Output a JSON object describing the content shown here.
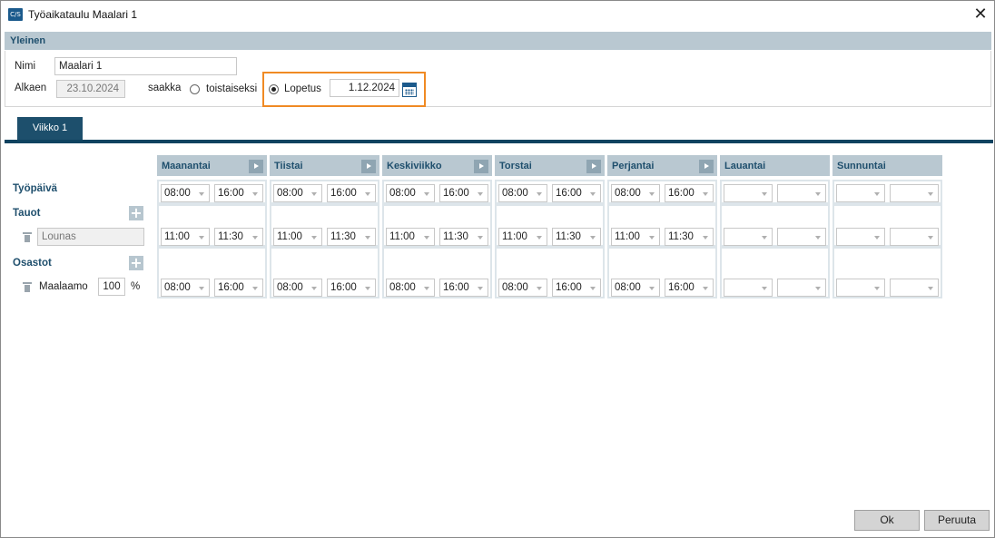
{
  "window": {
    "title": "Työaikataulu Maalari 1",
    "app_icon_text": "C/S",
    "close_glyph": "✕"
  },
  "general": {
    "header": "Yleinen",
    "name_label": "Nimi",
    "name_value": "Maalari 1",
    "start_label": "Alkaen",
    "start_value": "23.10.2024",
    "until_label": "saakka",
    "option_indefinite": "toistaiseksi",
    "option_end": "Lopetus",
    "selected_option": "Lopetus",
    "end_value": "1.12.2024"
  },
  "tabs": [
    {
      "label": "Viikko 1",
      "active": true
    }
  ],
  "rows": {
    "workday_label": "Työpäivä",
    "breaks_label": "Tauot",
    "break_name": "Lounas",
    "departments_label": "Osastot",
    "department_name": "Maalaamo",
    "department_percent": "100",
    "percent_sign": "%"
  },
  "plus_glyph": "+",
  "days": [
    {
      "name": "Maanantai",
      "work": [
        "08:00",
        "16:00"
      ],
      "break": [
        "11:00",
        "11:30"
      ],
      "dept": [
        "08:00",
        "16:00"
      ]
    },
    {
      "name": "Tiistai",
      "work": [
        "08:00",
        "16:00"
      ],
      "break": [
        "11:00",
        "11:30"
      ],
      "dept": [
        "08:00",
        "16:00"
      ]
    },
    {
      "name": "Keskiviikko",
      "work": [
        "08:00",
        "16:00"
      ],
      "break": [
        "11:00",
        "11:30"
      ],
      "dept": [
        "08:00",
        "16:00"
      ]
    },
    {
      "name": "Torstai",
      "work": [
        "08:00",
        "16:00"
      ],
      "break": [
        "11:00",
        "11:30"
      ],
      "dept": [
        "08:00",
        "16:00"
      ]
    },
    {
      "name": "Perjantai",
      "work": [
        "08:00",
        "16:00"
      ],
      "break": [
        "11:00",
        "11:30"
      ],
      "dept": [
        "08:00",
        "16:00"
      ]
    },
    {
      "name": "Lauantai",
      "work": [
        "",
        ""
      ],
      "break": [
        "",
        ""
      ],
      "dept": [
        "",
        ""
      ]
    },
    {
      "name": "Sunnuntai",
      "work": [
        "",
        ""
      ],
      "break": [
        "",
        ""
      ],
      "dept": [
        "",
        ""
      ]
    }
  ],
  "buttons": {
    "ok": "Ok",
    "cancel": "Peruuta"
  },
  "colors": {
    "accent": "#1d4f6c",
    "header_bg": "#b9c8d1",
    "highlight": "#f08a24"
  }
}
